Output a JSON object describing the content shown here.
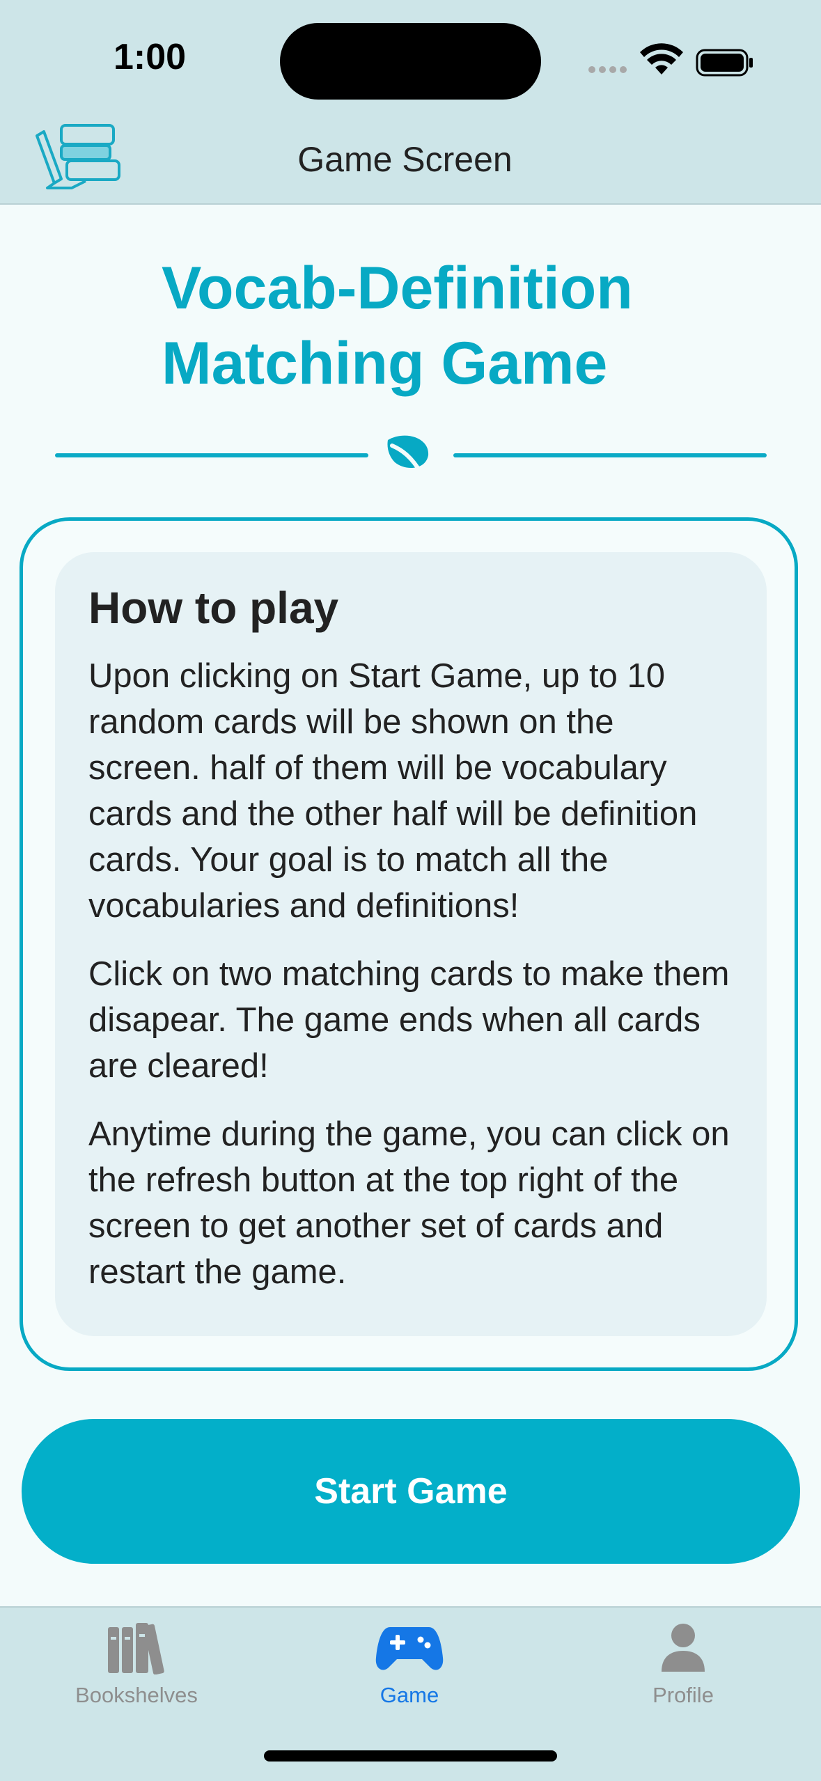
{
  "status_bar": {
    "time": "1:00"
  },
  "nav": {
    "title": "Game Screen",
    "logo_icon": "books-pencil-logo"
  },
  "header": {
    "title": "Vocab-Definition Matching Game",
    "divider_icon": "leaf-icon"
  },
  "how_to_play": {
    "title": "How to play",
    "paragraphs": [
      "Upon clicking on Start Game, up to 10 random cards will be shown on the screen. half of them will be vocabulary cards and the other half will be definition cards. Your goal is to match all the vocabularies and definitions!",
      "Click on two matching cards to make them disapear. The game ends when all cards are cleared!",
      "Anytime during the game, you can click on the refresh button at the top right of the screen to get another set of cards and restart the game."
    ]
  },
  "start_button": {
    "label": "Start Game"
  },
  "tabs": [
    {
      "label": "Bookshelves",
      "icon": "bookshelves-icon",
      "active": false
    },
    {
      "label": "Game",
      "icon": "gamecontroller-icon",
      "active": true
    },
    {
      "label": "Profile",
      "icon": "person-icon",
      "active": false
    }
  ],
  "colors": {
    "accent": "#07a9c4",
    "bar_background": "#cde5e8",
    "active_tab": "#1577e6",
    "inactive_tab": "#8e8e8e"
  }
}
